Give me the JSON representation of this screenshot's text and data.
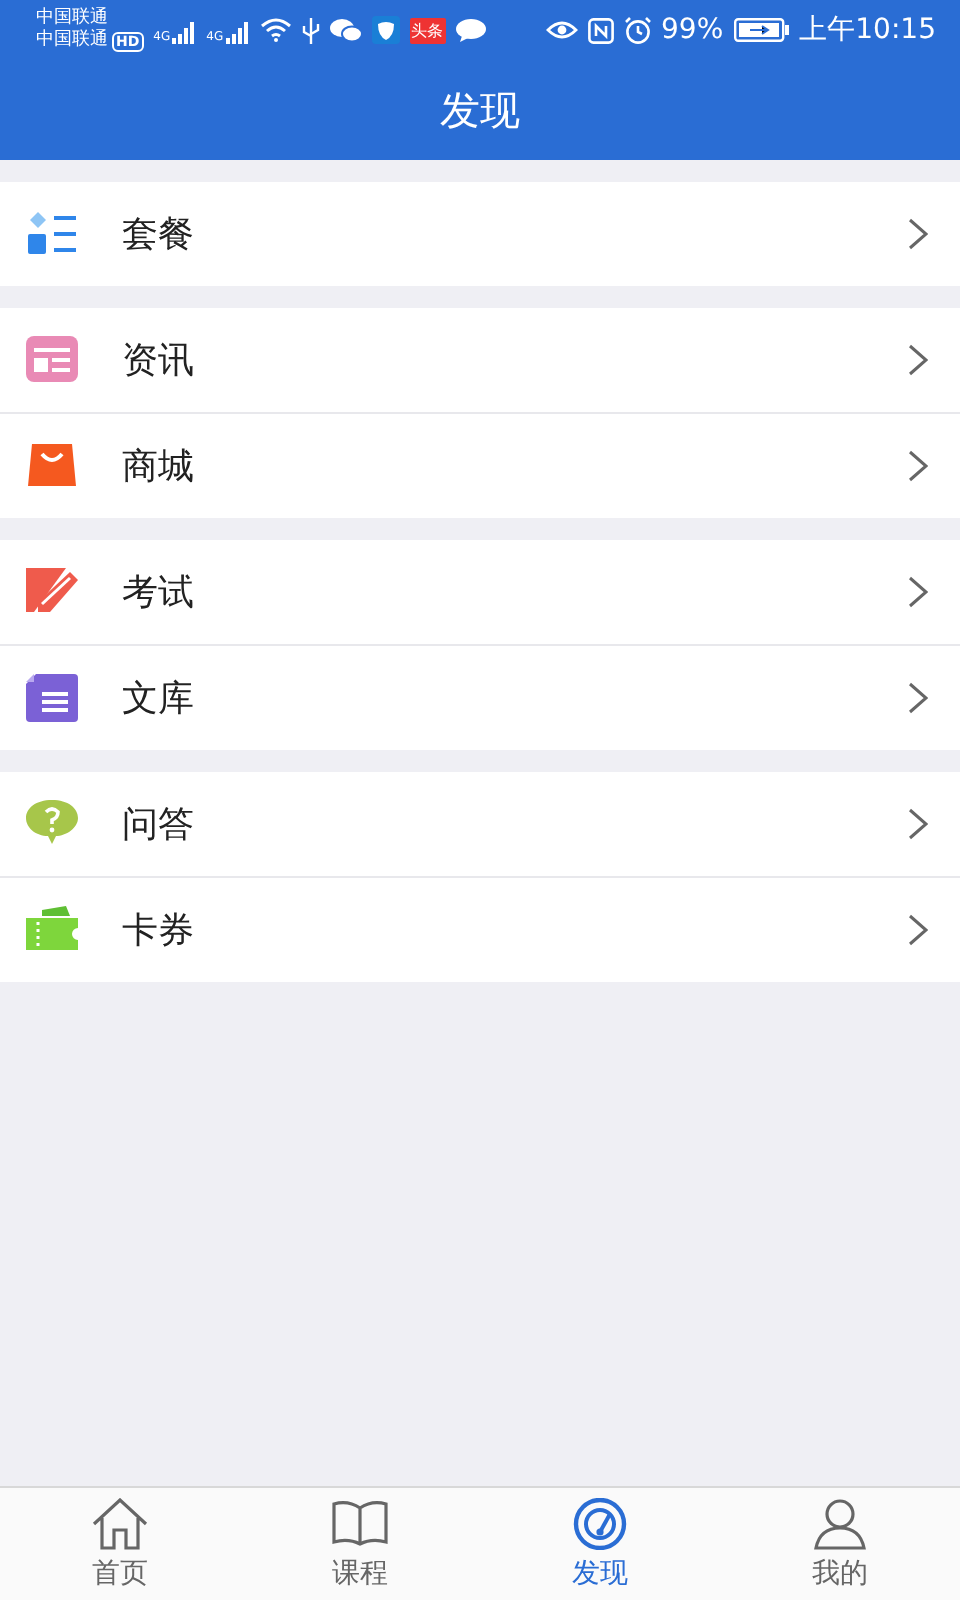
{
  "status_bar": {
    "carriers": [
      "中国联通",
      "中国联通"
    ],
    "hd": "HD",
    "network": [
      "4G",
      "4G"
    ],
    "news_app": "头条",
    "battery": "99%",
    "time": "上午10:15"
  },
  "title": "发现",
  "groups": [
    {
      "items": [
        {
          "kind": "package",
          "label": "套餐"
        }
      ]
    },
    {
      "items": [
        {
          "kind": "news",
          "label": "资讯"
        },
        {
          "kind": "shop",
          "label": "商城"
        }
      ]
    },
    {
      "items": [
        {
          "kind": "exam",
          "label": "考试"
        },
        {
          "kind": "library",
          "label": "文库"
        }
      ]
    },
    {
      "items": [
        {
          "kind": "qa",
          "label": "问答"
        },
        {
          "kind": "coupon",
          "label": "卡券"
        }
      ]
    }
  ],
  "tabs": [
    {
      "kind": "home",
      "label": "首页",
      "selected": false
    },
    {
      "kind": "course",
      "label": "课程",
      "selected": false
    },
    {
      "kind": "discover",
      "label": "发现",
      "selected": true
    },
    {
      "kind": "profile",
      "label": "我的",
      "selected": false
    }
  ]
}
